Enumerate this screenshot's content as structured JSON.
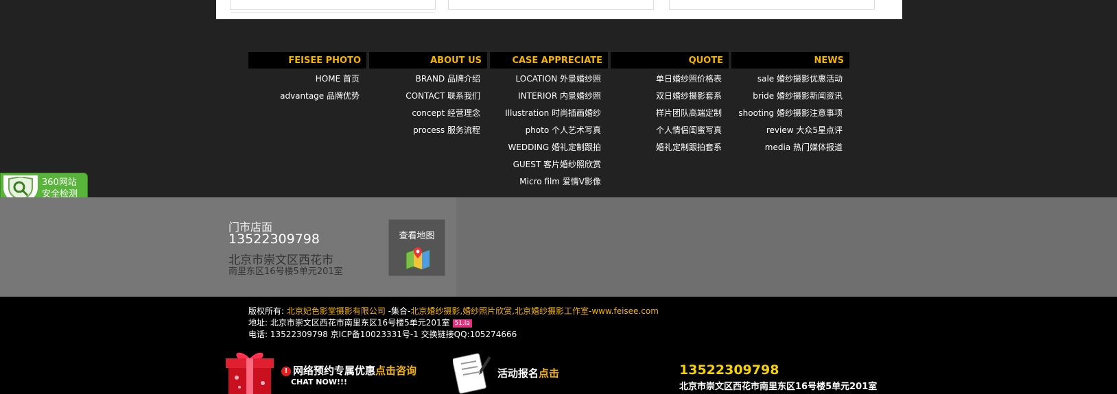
{
  "nav_columns": [
    {
      "title": "FEISEE PHOTO",
      "items": [
        "HOME 首页",
        "advantage 品牌优势"
      ]
    },
    {
      "title": "ABOUT US",
      "items": [
        "BRAND 品牌介绍",
        "CONTACT 联系我们",
        "concept 经营理念",
        "process 服务流程"
      ]
    },
    {
      "title": "CASE APPRECIATE",
      "items": [
        "LOCATION 外景婚纱照",
        "INTERIOR 内景婚纱照",
        "Illustration 时尚插画婚纱",
        "photo 个人艺术写真",
        "WEDDING 婚礼定制跟拍",
        "GUEST 客片婚纱照欣赏",
        "Micro film 爱情V影像"
      ]
    },
    {
      "title": "QUOTE",
      "items": [
        "单日婚纱照价格表",
        "双日婚纱摄影套系",
        "样片团队高端定制",
        "个人情侣闺蜜写真",
        "婚礼定制跟拍套系"
      ]
    },
    {
      "title": "NEWS",
      "items": [
        "sale 婚纱摄影优惠活动",
        "bride 婚纱摄影新闻资讯",
        "shooting 婚纱摄影注意事项",
        "review 大众5星点评",
        "media 热门媒体报道"
      ]
    }
  ],
  "badge360": {
    "line1": "360网站",
    "line2": "安全检测"
  },
  "store": {
    "label": "门市店面",
    "phone": "13522309798",
    "addr_line1": "北京市崇文区西花市",
    "addr_line2": "南里东区16号楼5单元201室",
    "map_button": "查看地图"
  },
  "copyright": {
    "prefix": "版权所有: ",
    "company": "北京妃色影堂摄影有限公司",
    "mid": " -集合-",
    "links": "北京婚纱摄影,婚纱照片欣赏,北京婚纱摄影工作室-www.feisee.com",
    "address": "地址: 北京市崇文区西花市南里东区16号楼5单元201室",
    "tag": "51.la",
    "phone_line": "电话: 13522309798 京ICP备10023331号-1 交换链接QQ:105274666"
  },
  "promo": {
    "excl": "!",
    "booking_text": "网络预约专属优惠",
    "booking_link": "点击咨询",
    "chat": "CHAT NOW!!!",
    "event_text": "活动报名",
    "event_link": "点击",
    "phone": "13522309798",
    "address": "北京市崇文区西花市南里东区16号楼5单元201室"
  }
}
